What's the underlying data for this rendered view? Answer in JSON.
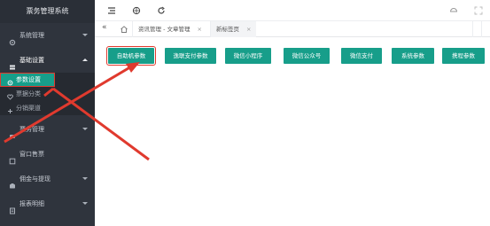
{
  "app": {
    "title": "票务管理系统"
  },
  "sidebar": {
    "items": [
      {
        "label": "系统管理",
        "icon": "gear-icon"
      },
      {
        "label": "基础设置",
        "icon": "layers-icon"
      },
      {
        "label": "票务管理",
        "icon": "ticket-icon"
      },
      {
        "label": "窗口售票",
        "icon": "window-icon"
      },
      {
        "label": "佣金与提现",
        "icon": "wallet-icon"
      },
      {
        "label": "报表明细",
        "icon": "report-icon"
      }
    ],
    "sub_items": [
      {
        "label": "参数设置",
        "icon": "settings-icon"
      },
      {
        "label": "票据分类",
        "icon": "heart-icon"
      },
      {
        "label": "分销渠道",
        "icon": "plus-icon"
      }
    ]
  },
  "tabs": [
    {
      "label": "资讯管理 - 文章管理"
    },
    {
      "label": "新标签页"
    }
  ],
  "buttons": [
    "自助机参数",
    "逸联支付参数",
    "微信小程序",
    "微信公众号",
    "微信支付",
    "系统参数",
    "携程参数"
  ],
  "colors": {
    "sidebar_bg": "#2f343d",
    "accent": "#179e8a",
    "annotation": "#e03a2e"
  }
}
